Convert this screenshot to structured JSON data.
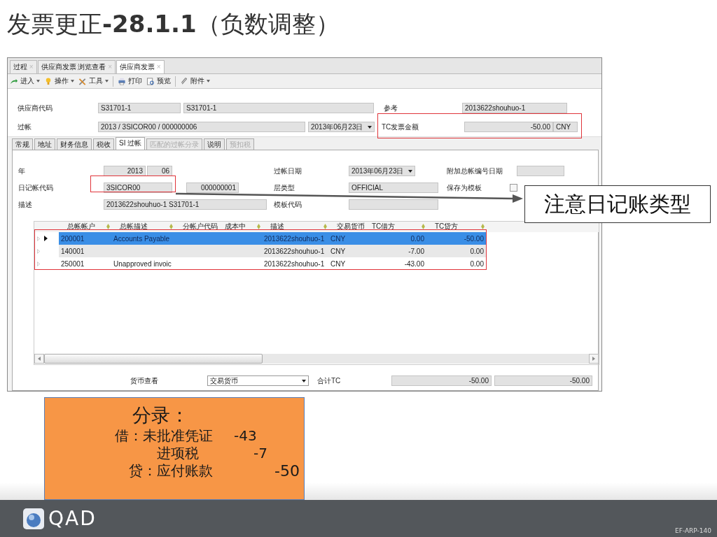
{
  "slide_title": "发票更正**-28.1.1**（负数调整）",
  "window": {
    "tabs": [
      {
        "label": "过程",
        "close": "×",
        "selected": false
      },
      {
        "label": "供应商发票 浏览查看",
        "close": "×",
        "selected": false
      },
      {
        "label": "供应商发票",
        "close": "×",
        "selected": true
      }
    ],
    "toolbar": [
      {
        "kind": "enter",
        "label": "进入",
        "caret": true
      },
      {
        "kind": "bulb",
        "label": "操作",
        "caret": true
      },
      {
        "kind": "tools",
        "label": "工具",
        "caret": true
      },
      {
        "kind": "separator"
      },
      {
        "kind": "printer",
        "label": "打印",
        "caret": false
      },
      {
        "kind": "preview",
        "label": "预览",
        "caret": false
      },
      {
        "kind": "separator"
      },
      {
        "kind": "paperclip",
        "label": "附件",
        "caret": true
      }
    ],
    "supplier": {
      "label": "供应商代码",
      "code": "S31701-1",
      "name": "S31701-1"
    },
    "reference": {
      "label": "参考",
      "value": "2013622shouhuo-1"
    },
    "posting": {
      "label": "过帐",
      "value": "2013 / 3SICOR00 / 000000006",
      "date": "2013年06月23日"
    },
    "tc_amount": {
      "label": "TC发票金额",
      "value": "-50.00",
      "currency": "CNY"
    },
    "form_tabs": [
      {
        "label": "常规",
        "selected": false,
        "disabled": false
      },
      {
        "label": "地址",
        "selected": false,
        "disabled": false
      },
      {
        "label": "财务信息",
        "selected": false,
        "disabled": false
      },
      {
        "label": "税收",
        "selected": false,
        "disabled": false
      },
      {
        "label": "SI 过帐",
        "selected": true,
        "disabled": false
      },
      {
        "label": "匹配的过帐分录",
        "selected": false,
        "disabled": true
      },
      {
        "label": "说明",
        "selected": false,
        "disabled": false
      },
      {
        "label": "预扣税",
        "selected": false,
        "disabled": true
      }
    ],
    "si_posting": {
      "year": {
        "label": "年",
        "year": "2013",
        "period": "06"
      },
      "journal": {
        "label": "日记帐代码",
        "code": "3SICOR00",
        "number": "000000001"
      },
      "description": {
        "label": "描述",
        "value": "2013622shouhuo-1 S31701-1"
      },
      "posting_date": {
        "label": "过帐日期",
        "value": "2013年06月23日"
      },
      "layer_type": {
        "label": "层类型",
        "value": "OFFICIAL"
      },
      "template_code": {
        "label": "模板代码"
      },
      "extra_gl_date": {
        "label": "附加总帐编号日期"
      },
      "save_as_template": {
        "label": "保存为模板",
        "checked": false
      }
    },
    "grid": {
      "columns": [
        "总帐帐户",
        "总帐描述",
        "分帐户代码",
        "成本中",
        "描述",
        "交易货币",
        "TC借方",
        "TC贷方"
      ],
      "rows": [
        {
          "selected": true,
          "cells": [
            "200001",
            "Accounts Payable",
            "",
            "",
            "2013622shouhuo-1",
            "CNY",
            "0.00",
            "-50.00"
          ]
        },
        {
          "selected": false,
          "cells": [
            "140001",
            "",
            "",
            "",
            "2013622shouhuo-1",
            "CNY",
            "-7.00",
            "0.00"
          ]
        },
        {
          "selected": false,
          "cells": [
            "250001",
            "Unapproved invoic",
            "",
            "",
            "2013622shouhuo-1",
            "CNY",
            "-43.00",
            "0.00"
          ]
        }
      ]
    },
    "currency_view": {
      "label": "货币查看",
      "value": "交易货币"
    },
    "total": {
      "label": "合计TC",
      "debit": "-50.00",
      "credit": "-50.00"
    }
  },
  "callout": "注意日记账类型",
  "entry_note": {
    "title": "分录：",
    "lines": [
      {
        "text": "借：未批准凭证",
        "amount": "-43"
      },
      {
        "text": "进项税",
        "amount": "-7"
      },
      {
        "text": "贷：应付账款",
        "amount": "-50"
      }
    ]
  },
  "footer": {
    "logo": "QAD",
    "code": "EF-ARP-140"
  }
}
